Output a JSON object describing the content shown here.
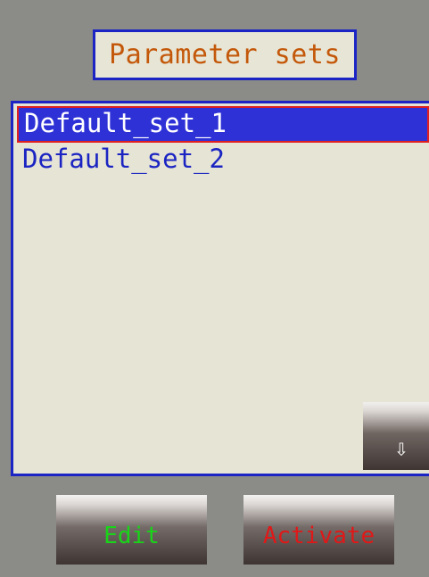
{
  "header": {
    "title": "Parameter sets"
  },
  "list": {
    "items": [
      {
        "label": "Default_set_1",
        "selected": true
      },
      {
        "label": "Default_set_2",
        "selected": false
      }
    ]
  },
  "scroll": {
    "down_icon": "down-arrow-icon",
    "down_glyph": "⇩"
  },
  "buttons": {
    "edit_label": "Edit",
    "activate_label": "Activate"
  },
  "colors": {
    "background": "#8b8b87",
    "panel": "#e5e4d5",
    "border": "#1c25c4",
    "title_text": "#c4580a",
    "selected_bg": "#2e31d6",
    "selected_border": "#e02020",
    "edit_text": "#19d419",
    "activate_text": "#e01818"
  }
}
